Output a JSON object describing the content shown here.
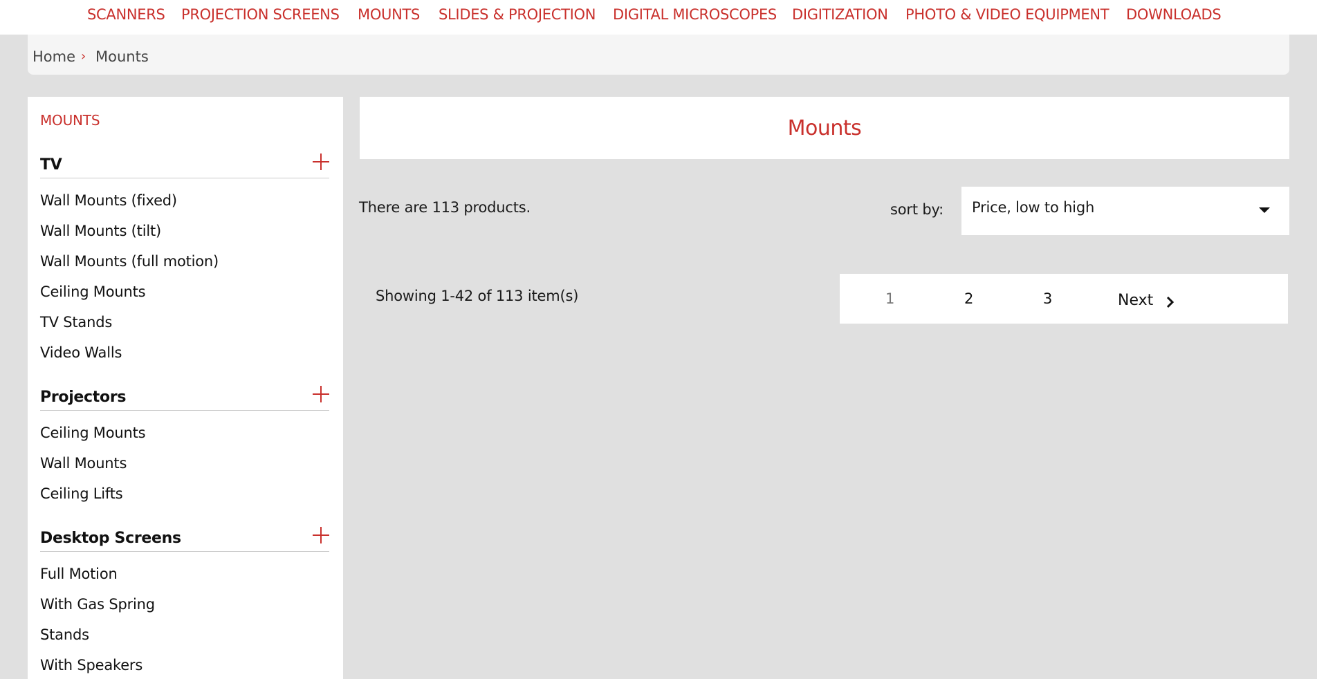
{
  "topnav": {
    "items": [
      "SCANNERS",
      "PROJECTION SCREENS",
      "MOUNTS",
      "SLIDES & PROJECTION",
      "DIGITAL MICROSCOPES",
      "DIGITIZATION",
      "PHOTO & VIDEO EQUIPMENT",
      "DOWNLOADS"
    ]
  },
  "breadcrumb": {
    "home": "Home",
    "separator": "›",
    "current": "Mounts"
  },
  "sidebar": {
    "title": "MOUNTS",
    "groups": [
      {
        "label": "TV",
        "items": [
          "Wall Mounts (fixed)",
          "Wall Mounts (tilt)",
          "Wall Mounts (full motion)",
          "Ceiling Mounts",
          "TV Stands",
          "Video Walls"
        ]
      },
      {
        "label": "Projectors",
        "items": [
          "Ceiling Mounts",
          "Wall Mounts",
          "Ceiling Lifts"
        ]
      },
      {
        "label": "Desktop Screens",
        "items": [
          "Full Motion",
          "With Gas Spring",
          "Stands",
          "With Speakers"
        ]
      }
    ]
  },
  "main": {
    "title": "Mounts",
    "product_count": "There are 113 products.",
    "sort_label": "sort by:",
    "sort_value": "Price, low to high",
    "showing": "Showing 1-42 of 113 item(s)",
    "pagination": {
      "pages": [
        "1",
        "2",
        "3"
      ],
      "current": "1",
      "next": "Next"
    }
  },
  "colors": {
    "accent": "#c9302c",
    "background": "#e0e0e0",
    "panel": "#ffffff"
  },
  "icons": {
    "expand": "plus-icon",
    "sort": "caret-down-icon",
    "next": "chevron-right-icon",
    "breadcrumb_sep": "chevron-right-icon"
  }
}
